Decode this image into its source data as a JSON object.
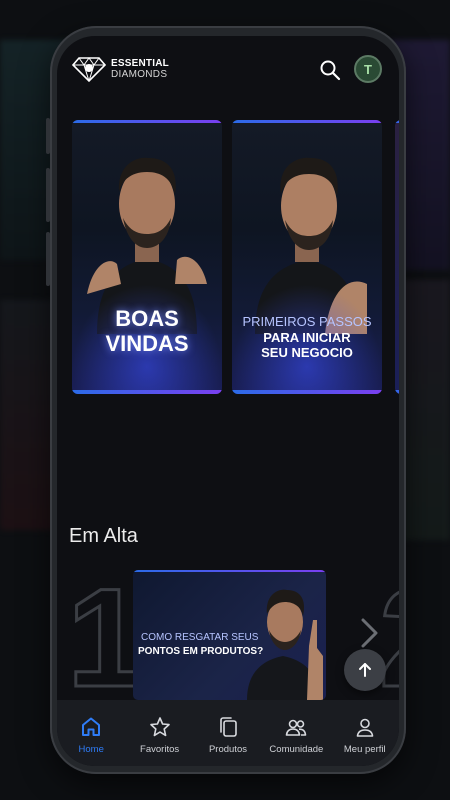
{
  "app": {
    "brand_line1": "ESSENTIAL",
    "brand_line2": "DIAMONDS",
    "avatar_initial": "T"
  },
  "banners": [
    {
      "title_line1": "BOAS",
      "title_line2": "VINDAS"
    },
    {
      "line1": "PRIMEIROS PASSOS",
      "line2": "PARA INICIAR",
      "line3": "SEU NEGOCIO"
    }
  ],
  "trending": {
    "title": "Em Alta",
    "items": [
      {
        "rank": "1",
        "line1": "COMO RESGATAR SEUS",
        "line2": "PONTOS EM PRODUTOS?"
      }
    ],
    "next_rank": "2"
  },
  "nav": {
    "items": [
      {
        "label": "Home",
        "icon": "home-icon",
        "active": true
      },
      {
        "label": "Favoritos",
        "icon": "star-icon",
        "active": false
      },
      {
        "label": "Produtos",
        "icon": "copy-icon",
        "active": false
      },
      {
        "label": "Comunidade",
        "icon": "people-icon",
        "active": false
      },
      {
        "label": "Meu perfil",
        "icon": "user-icon",
        "active": false
      }
    ]
  },
  "colors": {
    "accent": "#2f7cf6",
    "background": "#0e0f13",
    "nav_background": "#1a1c21"
  }
}
